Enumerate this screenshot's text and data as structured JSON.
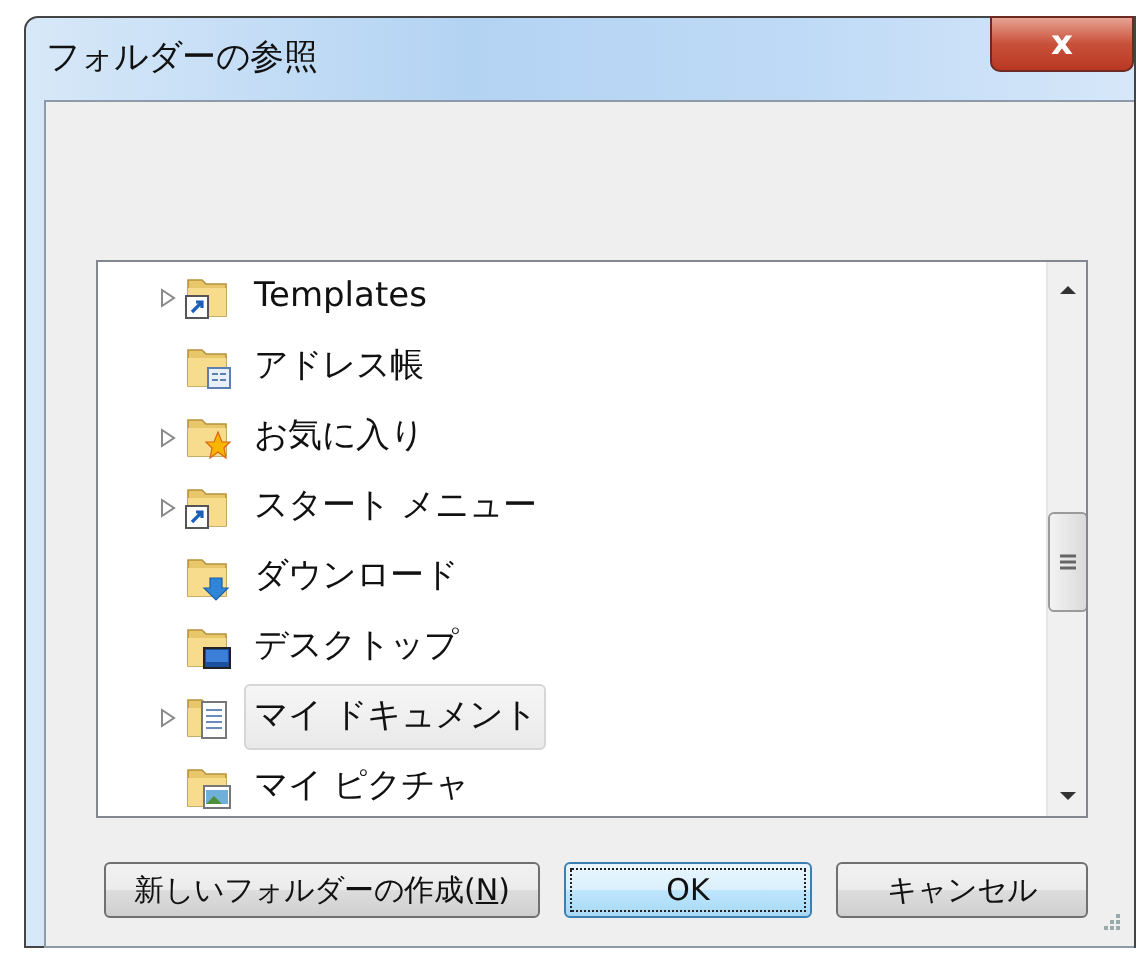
{
  "window": {
    "title": "フォルダーの参照",
    "close_label": "x"
  },
  "tree": {
    "items": [
      {
        "label": "Templates",
        "kind": "shortcut",
        "has_children": true,
        "selected": false
      },
      {
        "label": "アドレス帳",
        "kind": "contacts",
        "has_children": false,
        "selected": false
      },
      {
        "label": "お気に入り",
        "kind": "favorites",
        "has_children": true,
        "selected": false
      },
      {
        "label": "スタート メニュー",
        "kind": "shortcut",
        "has_children": true,
        "selected": false
      },
      {
        "label": "ダウンロード",
        "kind": "download",
        "has_children": false,
        "selected": false
      },
      {
        "label": "デスクトップ",
        "kind": "desktop",
        "has_children": false,
        "selected": false
      },
      {
        "label": "マイ ドキュメント",
        "kind": "documents",
        "has_children": true,
        "selected": true
      },
      {
        "label": "マイ ピクチャ",
        "kind": "pictures",
        "has_children": false,
        "selected": false
      }
    ]
  },
  "buttons": [
    {
      "label_before": "新しいフォルダーの作成(",
      "access_key": "N",
      "label_after": ")",
      "default": false
    },
    {
      "label_before": "OK",
      "default": true
    },
    {
      "label_before": "キャンセル",
      "default": false
    }
  ]
}
